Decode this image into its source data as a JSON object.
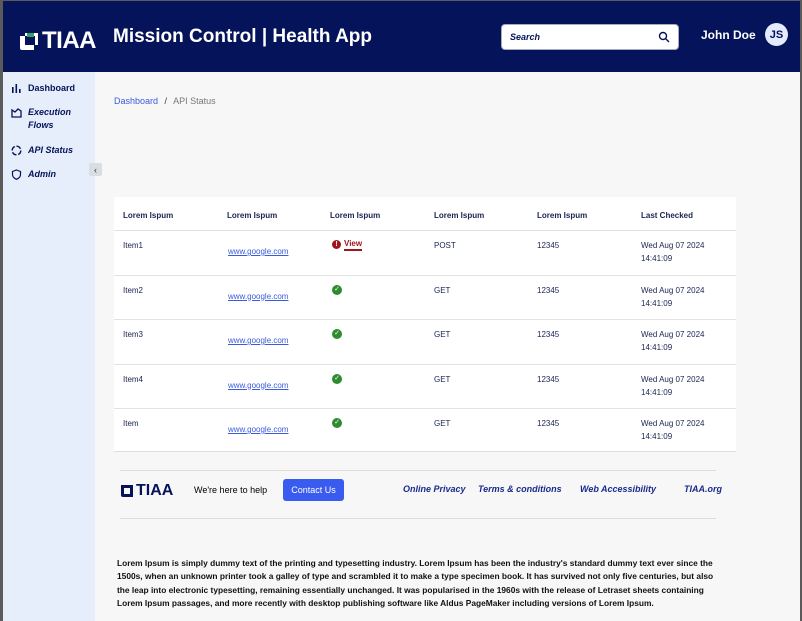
{
  "header": {
    "logo": "TIAA",
    "title": "Mission Control | Health App",
    "search_placeholder": "Search",
    "user_name": "John Doe",
    "avatar_initials": "JS"
  },
  "sidebar": {
    "items": [
      {
        "label": "Dashboard",
        "icon": "bar-chart-icon"
      },
      {
        "label": "Execution Flows",
        "icon": "flow-icon"
      },
      {
        "label": "API Status",
        "icon": "status-ring-icon"
      },
      {
        "label": "Admin",
        "icon": "shield-icon"
      }
    ],
    "collapse": "‹"
  },
  "breadcrumb": {
    "home": "Dashboard",
    "sep": "/",
    "current": "API Status"
  },
  "table": {
    "headers": [
      "Lorem Ispum",
      "Lorem Ispum",
      "Lorem Ispum",
      "Lorem Ispum",
      "Lorem Ispum",
      "Last Checked"
    ],
    "rows": [
      {
        "name": "Item1",
        "url": "www.google.com",
        "status": "error",
        "status_label": "View",
        "method": "POST",
        "code": "12345",
        "date": "Wed Aug 07 2024",
        "time": "14:41:09"
      },
      {
        "name": "Item2",
        "url": "www.google.com",
        "status": "ok",
        "method": "GET",
        "code": "12345",
        "date": "Wed Aug 07 2024",
        "time": "14:41:09"
      },
      {
        "name": "Item3",
        "url": "www.google.com",
        "status": "ok",
        "method": "GET",
        "code": "12345",
        "date": "Wed Aug 07 2024",
        "time": "14:41:09"
      },
      {
        "name": "Item4",
        "url": "www.google.com",
        "status": "ok",
        "method": "GET",
        "code": "12345",
        "date": "Wed Aug 07 2024",
        "time": "14:41:09"
      },
      {
        "name": "Item",
        "url": "www.google.com",
        "status": "ok",
        "method": "GET",
        "code": "12345",
        "date": "Wed Aug 07 2024",
        "time": "14:41:09"
      }
    ]
  },
  "footer": {
    "logo": "TIAA",
    "help": "We're here to help",
    "contact": "Contact Us",
    "links": [
      "Online Privacy",
      "Terms & conditions",
      "Web Accessibility",
      "TIAA.org"
    ],
    "text": "Lorem Ipsum is simply dummy text of the printing and typesetting industry. Lorem Ipsum has been the industry's standard dummy text ever since the 1500s, when an unknown printer took a galley of type and scrambled it to make a type specimen book. It has survived not only five centuries, but also the leap into electronic typesetting, remaining essentially unchanged. It was popularised in the 1960s with the release of Letraset sheets containing Lorem Ipsum passages, and more recently with desktop publishing software like Aldus PageMaker including versions of Lorem Ipsum."
  },
  "colors": {
    "header": "#04135a",
    "sidebar": "#e6eefb",
    "accent": "#3a5bf0",
    "error": "#a0141e",
    "ok": "#2e8b2e"
  }
}
